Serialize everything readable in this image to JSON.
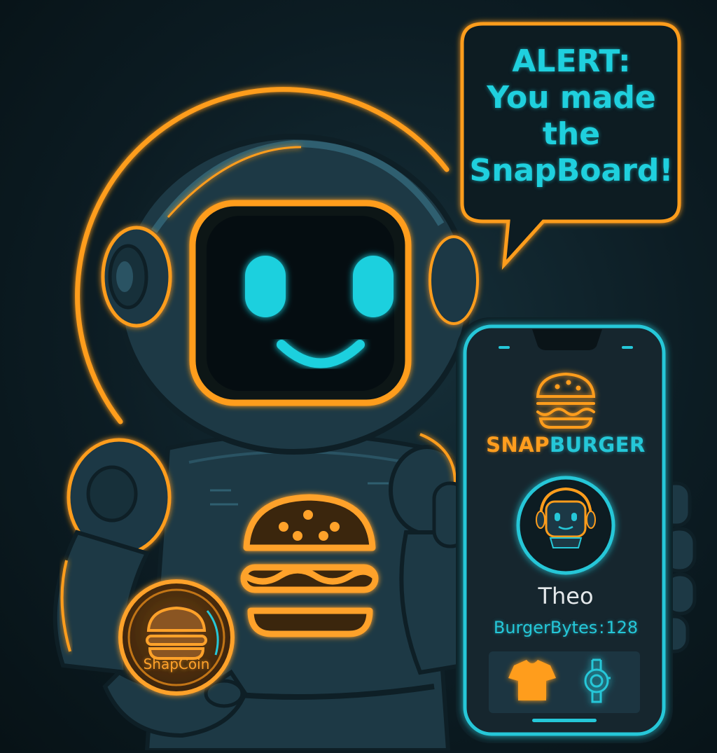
{
  "speech_bubble": {
    "lines": [
      "ALERT:",
      "You made",
      "the",
      "SnapBoard!"
    ]
  },
  "phone": {
    "brand_part1": "SNAP",
    "brand_part2": "BURGER",
    "username": "Theo",
    "points_label": "BurgerBytes",
    "points_separator": ":",
    "points_value": "128",
    "tabs": [
      {
        "icon": "tshirt-icon"
      },
      {
        "icon": "watch-icon"
      }
    ]
  },
  "coin": {
    "label": "ShapCoin"
  },
  "colors": {
    "neon_orange": "#ff9d1e",
    "neon_cyan": "#1fd0de",
    "background": "#0c1c23",
    "robot_body": "#1d3945"
  }
}
